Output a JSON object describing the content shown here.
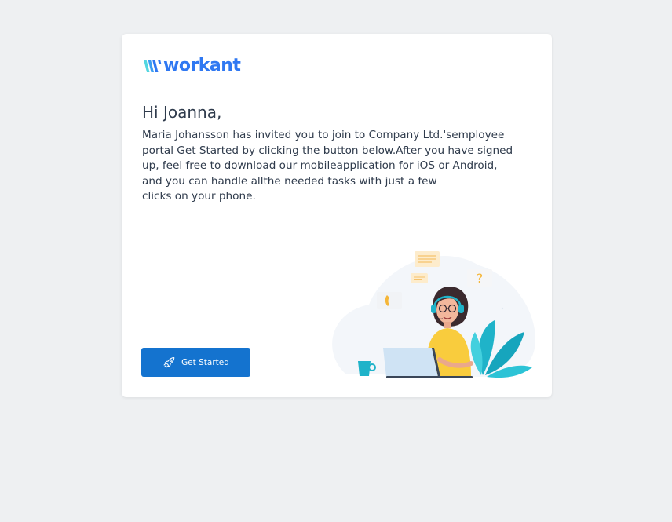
{
  "brand": {
    "name": "workant",
    "colors": {
      "primary": "#2f78f2",
      "button": "#1473cf",
      "text": "#2f3b4c",
      "background": "#eef0f2"
    }
  },
  "email": {
    "greeting": "Hi Joanna,",
    "body_lines": [
      "Maria Johansson has invited you to join to Company Ltd.'semployee",
      "portal Get Started by clicking the button below.After you have signed",
      "up, feel free to download our mobileapplication for iOS or Android,",
      "and you can handle allthe needed tasks with just a few",
      "clicks on your phone."
    ],
    "cta": {
      "label": "Get Started",
      "icon": "rocket-icon"
    },
    "illustration": {
      "icon": "support-agent-illustration",
      "chat_symbol": "?"
    }
  }
}
